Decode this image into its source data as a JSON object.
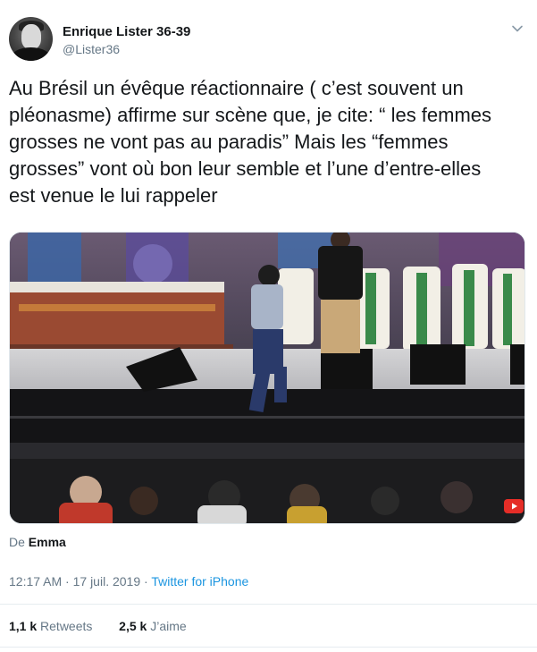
{
  "user": {
    "display_name": "Enrique Lister 36-39",
    "handle": "@Lister36"
  },
  "tweet": {
    "text": "Au Brésil un évêque réactionnaire ( c’est souvent un\npléonasme) affirme sur scène que, je cite: “ les femmes\ngrosses ne vont pas  au paradis” Mais les  “femmes\ngrosses” vont où bon leur semble et l’une d’entre-elles\nest venue le lui rappeler",
    "source_prefix": "De",
    "source_name": "Emma",
    "time": "12:17 AM",
    "separator1": "·",
    "date": "17 juil. 2019",
    "separator2": "·",
    "via": "Twitter for iPhone"
  },
  "stats": {
    "retweets_count": "1,1 k",
    "retweets_label": "Retweets",
    "likes_count": "2,5 k",
    "likes_label": "J’aime"
  },
  "icons": {
    "caret": "chevron-down-icon",
    "youtube": "youtube-icon"
  },
  "colors": {
    "link": "#1b95e0",
    "secondary_text": "#657786",
    "youtube_red": "#e52d27"
  }
}
